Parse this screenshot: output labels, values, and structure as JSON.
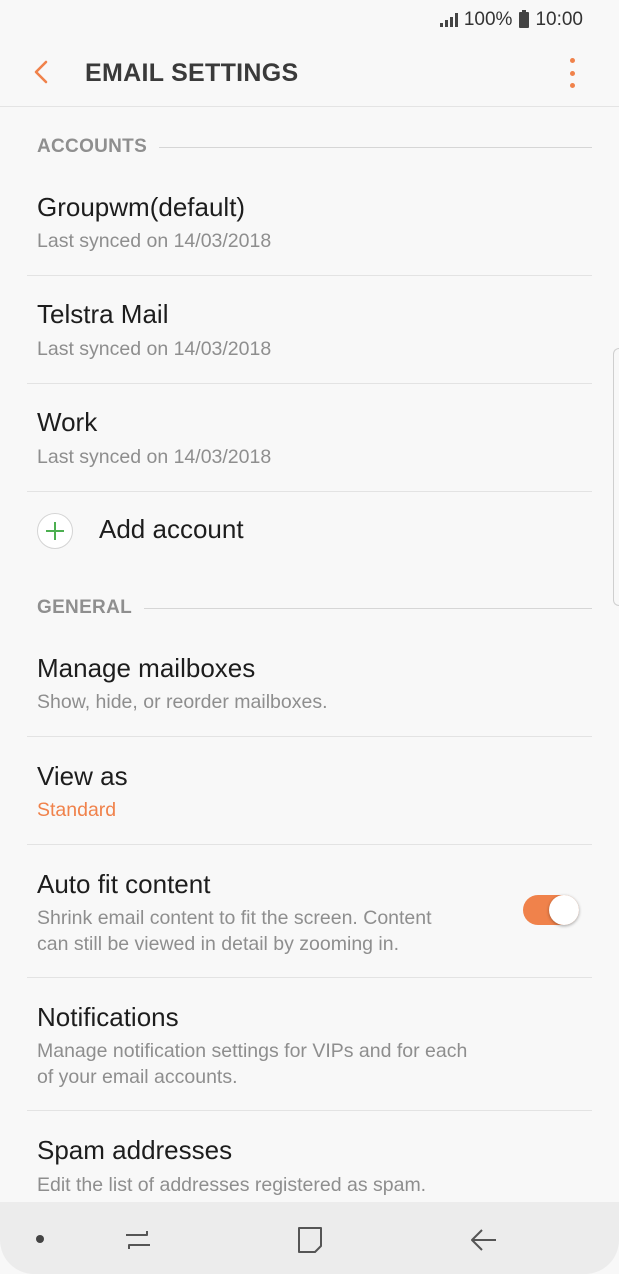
{
  "status_bar": {
    "battery": "100%",
    "time": "10:00"
  },
  "app_bar": {
    "title": "EMAIL SETTINGS"
  },
  "accounts_section": {
    "header": "ACCOUNTS",
    "items": [
      {
        "name": "Groupwm(default)",
        "sync": "Last synced on 14/03/2018"
      },
      {
        "name": "Telstra Mail",
        "sync": "Last synced on 14/03/2018"
      },
      {
        "name": "Work",
        "sync": "Last synced on 14/03/2018"
      }
    ],
    "add_account": "Add account"
  },
  "general_section": {
    "header": "GENERAL",
    "manage_mailboxes": {
      "title": "Manage mailboxes",
      "sub": "Show, hide, or reorder mailboxes."
    },
    "view_as": {
      "title": "View as",
      "value": "Standard"
    },
    "auto_fit": {
      "title": "Auto fit content",
      "sub_line1": "Shrink email content to fit the screen. Content",
      "sub_line2": "can still be viewed in detail by zooming in.",
      "enabled": true
    },
    "notifications": {
      "title": "Notifications",
      "sub_line1": "Manage notification settings for VIPs and for each",
      "sub_line2": "of your email accounts."
    },
    "spam": {
      "title": "Spam addresses",
      "sub": "Edit the list of addresses registered as spam."
    }
  },
  "colors": {
    "accent": "#f0824b",
    "add_icon": "#4caf50"
  },
  "icons": {
    "back": "back-arrow-icon",
    "more": "more-vert-icon",
    "add": "plus-circle-icon",
    "nav_recents": "recents-icon",
    "nav_home": "home-icon",
    "nav_back": "nav-back-icon"
  }
}
